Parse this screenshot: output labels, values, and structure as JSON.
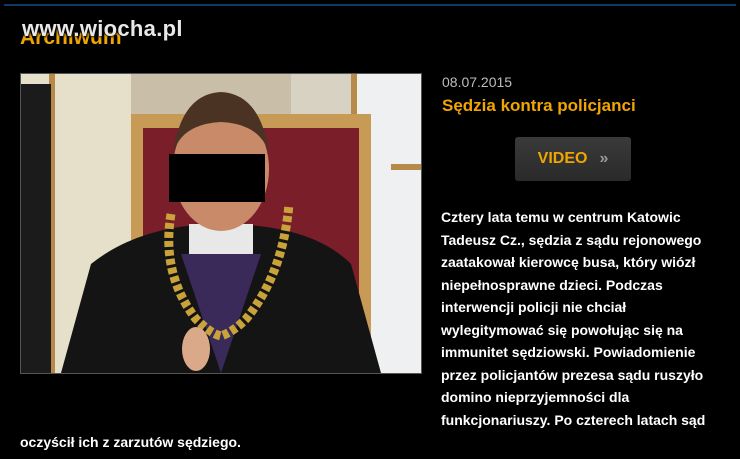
{
  "section": {
    "title": "Archiwum"
  },
  "watermark": "www.wiocha.pl",
  "article": {
    "date": "08.07.2015",
    "title": "Sędzia kontra policjanci",
    "video_label": "VIDEO",
    "video_chevron": "»",
    "lead": "Cztery lata temu w centrum Katowic Tadeusz Cz., sędzia z sądu rejonowego zaatakował kierowcę busa, który wiózł niepełnosprawne dzieci. Podczas interwencji policji nie chciał wylegitymować się powołując się na immunitet sędziowski. Powiadomienie przez policjantów prezesa sądu ruszyło domino nieprzyjemności dla funkcjonariuszy. Po czterech latach sąd oczyścił ich z zarzutów sędziego."
  },
  "colors": {
    "accent": "#f0a500",
    "background": "#000000",
    "frame_top": "#0e3a63"
  }
}
